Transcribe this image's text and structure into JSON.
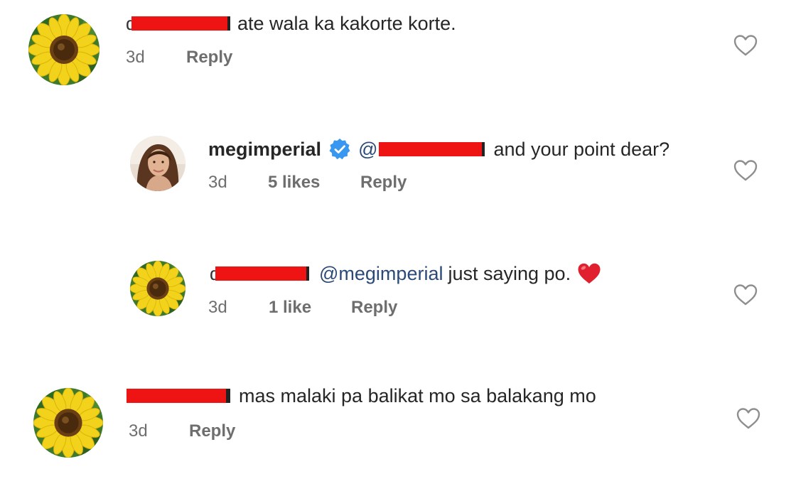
{
  "comments": [
    {
      "text": "ate wala ka kakorte korte.",
      "time": "3d",
      "reply_label": "Reply"
    },
    {
      "username": "megimperial",
      "mention": "@",
      "text": "and your point dear?",
      "time": "3d",
      "likes": "5 likes",
      "reply_label": "Reply"
    },
    {
      "mention": "@megimperial",
      "text": "just saying po.",
      "time": "3d",
      "likes": "1 like",
      "reply_label": "Reply"
    },
    {
      "text": "mas malaki pa balikat mo sa balakang mo",
      "time": "3d",
      "reply_label": "Reply"
    }
  ],
  "icons": {
    "like": "heart-outline-icon",
    "verified": "verified-badge-icon",
    "emoji": "red-heart-emoji-icon",
    "avatar_sunflower": "sunflower-avatar",
    "avatar_person": "profile-photo-avatar"
  },
  "colors": {
    "redaction": "#ee1414",
    "verified_blue": "#3897f0",
    "mention": "#2c4a78",
    "meta_gray": "#6e6e6e"
  }
}
